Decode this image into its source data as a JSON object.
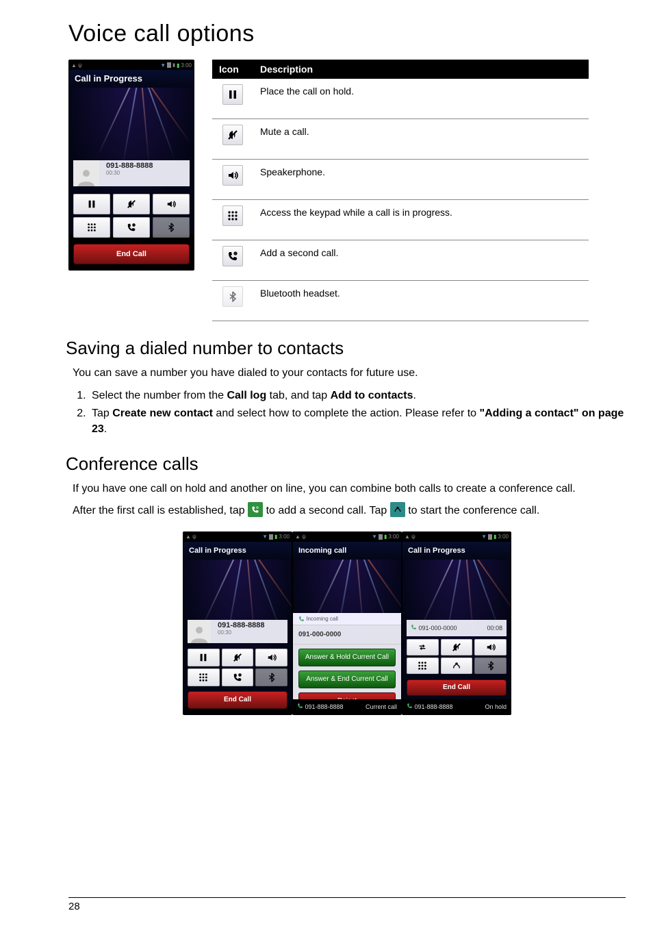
{
  "pageNumber": "28",
  "mainTitle": "Voice call options",
  "table": {
    "hIcon": "Icon",
    "hDesc": "Description",
    "rows": [
      {
        "desc": "Place the call on hold."
      },
      {
        "desc": "Mute a call."
      },
      {
        "desc": "Speakerphone."
      },
      {
        "desc": "Access the keypad while a call is in progress."
      },
      {
        "desc": "Add a second call."
      },
      {
        "desc": "Bluetooth headset."
      }
    ]
  },
  "phoneMain": {
    "statusTime": "3:00",
    "title": "Call in Progress",
    "number": "091-888-8888",
    "duration": "00:30",
    "endCall": "End Call"
  },
  "section2": {
    "title": "Saving a dialed number to contacts",
    "intro": "You can save a number you have dialed to your contacts for future use.",
    "step1_a": "Select the number from the ",
    "step1_b": "Call log",
    "step1_c": " tab, and tap ",
    "step1_d": "Add to contacts",
    "step1_e": ".",
    "step2_a": "Tap ",
    "step2_b": "Create new contact",
    "step2_c": " and select how to complete the action. Please refer to ",
    "step2_d": "\"Adding a contact\" on page 23",
    "step2_e": "."
  },
  "section3": {
    "title": "Conference calls",
    "p1": "If you have one call on hold and another on line, you can combine both calls to create a conference call.",
    "p2_a": "After the first call is established, tap ",
    "p2_b": " to add a second call. Tap ",
    "p2_c": " to start the conference call."
  },
  "shotA": {
    "title": "Call in Progress",
    "number": "091-888-8888",
    "duration": "00:30",
    "endCall": "End Call",
    "statusTime": "3:00"
  },
  "shotB": {
    "title": "Incoming call",
    "incoming": "Incoming call",
    "number": "091-000-0000",
    "btn1": "Answer & Hold Current Call",
    "btn2": "Answer & End Current Call",
    "btn3": "Reject",
    "footNum": "091-888-8888",
    "footLabel": "Current call",
    "statusTime": "3:00"
  },
  "shotC": {
    "title": "Call in Progress",
    "call1num": "091-000-0000",
    "call1dur": "00:08",
    "endCall": "End Call",
    "footNum": "091-888-8888",
    "footLabel": "On hold",
    "statusTime": "3:00"
  }
}
